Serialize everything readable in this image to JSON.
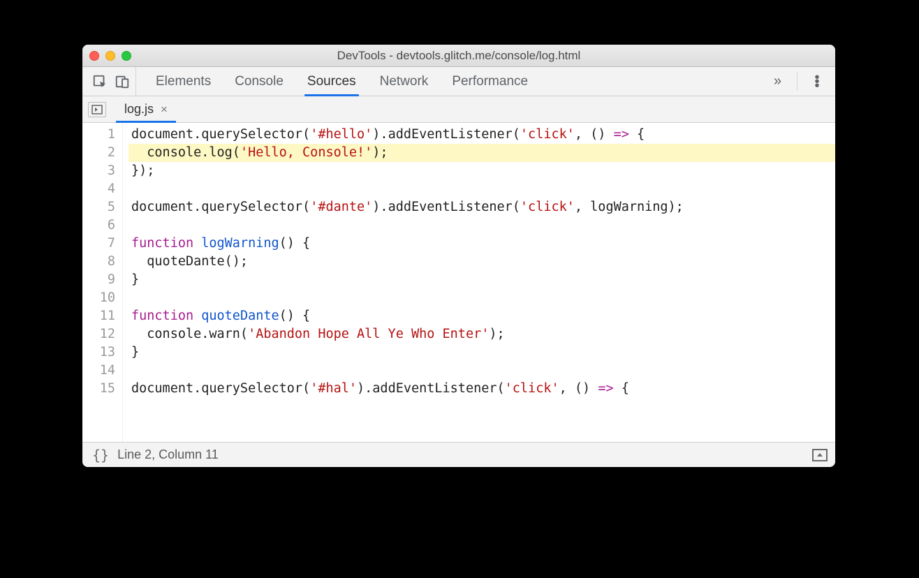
{
  "window": {
    "title": "DevTools - devtools.glitch.me/console/log.html"
  },
  "tabs": {
    "elements": "Elements",
    "console": "Console",
    "sources": "Sources",
    "network": "Network",
    "performance": "Performance",
    "more": "»",
    "active": "sources"
  },
  "file_tab": {
    "name": "log.js",
    "close": "×"
  },
  "code": {
    "highlighted_line": 2,
    "lines": [
      [
        {
          "t": "document.querySelector("
        },
        {
          "t": "'#hello'",
          "c": "str"
        },
        {
          "t": ").addEventListener("
        },
        {
          "t": "'click'",
          "c": "str"
        },
        {
          "t": ", () "
        },
        {
          "t": "=>",
          "c": "kw"
        },
        {
          "t": " {"
        }
      ],
      [
        {
          "t": "  console.log("
        },
        {
          "t": "'Hello, Console!'",
          "c": "str"
        },
        {
          "t": ");"
        }
      ],
      [
        {
          "t": "});"
        }
      ],
      [
        {
          "t": ""
        }
      ],
      [
        {
          "t": "document.querySelector("
        },
        {
          "t": "'#dante'",
          "c": "str"
        },
        {
          "t": ").addEventListener("
        },
        {
          "t": "'click'",
          "c": "str"
        },
        {
          "t": ", logWarning);"
        }
      ],
      [
        {
          "t": ""
        }
      ],
      [
        {
          "t": "function",
          "c": "kw"
        },
        {
          "t": " "
        },
        {
          "t": "logWarning",
          "c": "def"
        },
        {
          "t": "() {"
        }
      ],
      [
        {
          "t": "  quoteDante();"
        }
      ],
      [
        {
          "t": "}"
        }
      ],
      [
        {
          "t": ""
        }
      ],
      [
        {
          "t": "function",
          "c": "kw"
        },
        {
          "t": " "
        },
        {
          "t": "quoteDante",
          "c": "def"
        },
        {
          "t": "() {"
        }
      ],
      [
        {
          "t": "  console.warn("
        },
        {
          "t": "'Abandon Hope All Ye Who Enter'",
          "c": "str"
        },
        {
          "t": ");"
        }
      ],
      [
        {
          "t": "}"
        }
      ],
      [
        {
          "t": ""
        }
      ],
      [
        {
          "t": "document.querySelector("
        },
        {
          "t": "'#hal'",
          "c": "str"
        },
        {
          "t": ").addEventListener("
        },
        {
          "t": "'click'",
          "c": "str"
        },
        {
          "t": ", () "
        },
        {
          "t": "=>",
          "c": "kw"
        },
        {
          "t": " {"
        }
      ]
    ]
  },
  "status": {
    "braces": "{}",
    "position": "Line 2, Column 11"
  }
}
